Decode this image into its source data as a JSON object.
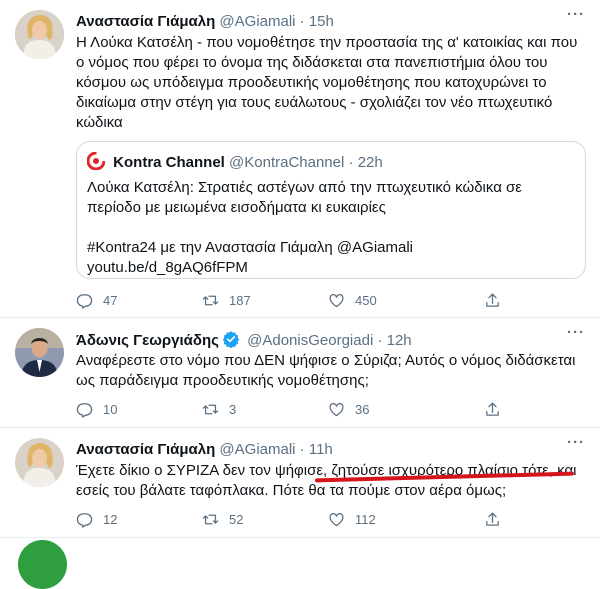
{
  "tweets": [
    {
      "name": "Αναστασία Γιάμαλη",
      "handle": "@AGiamali",
      "sep": "·",
      "time": "15h",
      "text": "Η Λούκα Κατσέλη - που νομοθέτησε την προστασία της α' κατοικίας και που ο νόμος που φέρει το όνομα της διδάσκεται στα πανεπιστήμια όλου του κόσμου ως υπόδειγμα προοδευτικής νομοθέτησης που κατοχυρώνει το δικαίωμα στην στέγη για τους ευάλωτους - σχολιάζει τον νέο πτωχευτικό κώδικα",
      "quote": {
        "name": "Kontra Channel",
        "handle": "@KontraChannel",
        "sep": "·",
        "time": "22h",
        "text1": "Λούκα Κατσέλη: Στρατιές αστέγων από την πτωχευτικό κώδικα σε περίοδο με μειωμένα εισοδήματα κι ευκαιρίες",
        "text2": "#Kontra24 με την Αναστασία Γιάμαλη @AGiamali",
        "link": "youtu.be/d_8gAQ6fFPM"
      },
      "reply_count": "47",
      "retweet_count": "187",
      "like_count": "450"
    },
    {
      "name": "Άδωνις Γεωργιάδης",
      "handle": "@AdonisGeorgiadi",
      "sep": "·",
      "time": "12h",
      "text": "Αναφέρεστε στο νόμο που ΔΕΝ ψήφισε ο Σύριζα; Αυτός ο νόμος διδάσκεται ως παράδειγμα προοδευτικής νομοθέτησης;",
      "reply_count": "10",
      "retweet_count": "3",
      "like_count": "36"
    },
    {
      "name": "Αναστασία Γιάμαλη",
      "handle": "@AGiamali",
      "sep": "·",
      "time": "11h",
      "text": "Έχετε δίκιο ο ΣΥΡΙΖΑ δεν τον ψήφισε, ζητούσε ισχυρότερο πλαίσιο τότε, και εσείς του βάλατε ταφόπλακα. Πότε θα τα πούμε στον αέρα όμως;",
      "reply_count": "12",
      "retweet_count": "52",
      "like_count": "112"
    }
  ],
  "colors": {
    "verified": "#1da1f2",
    "annotation": "#d4151c",
    "kontra_brand": "#e0262b"
  },
  "icons": [
    "reply-icon",
    "retweet-icon",
    "like-icon",
    "share-icon",
    "more-icon",
    "verified-icon"
  ]
}
